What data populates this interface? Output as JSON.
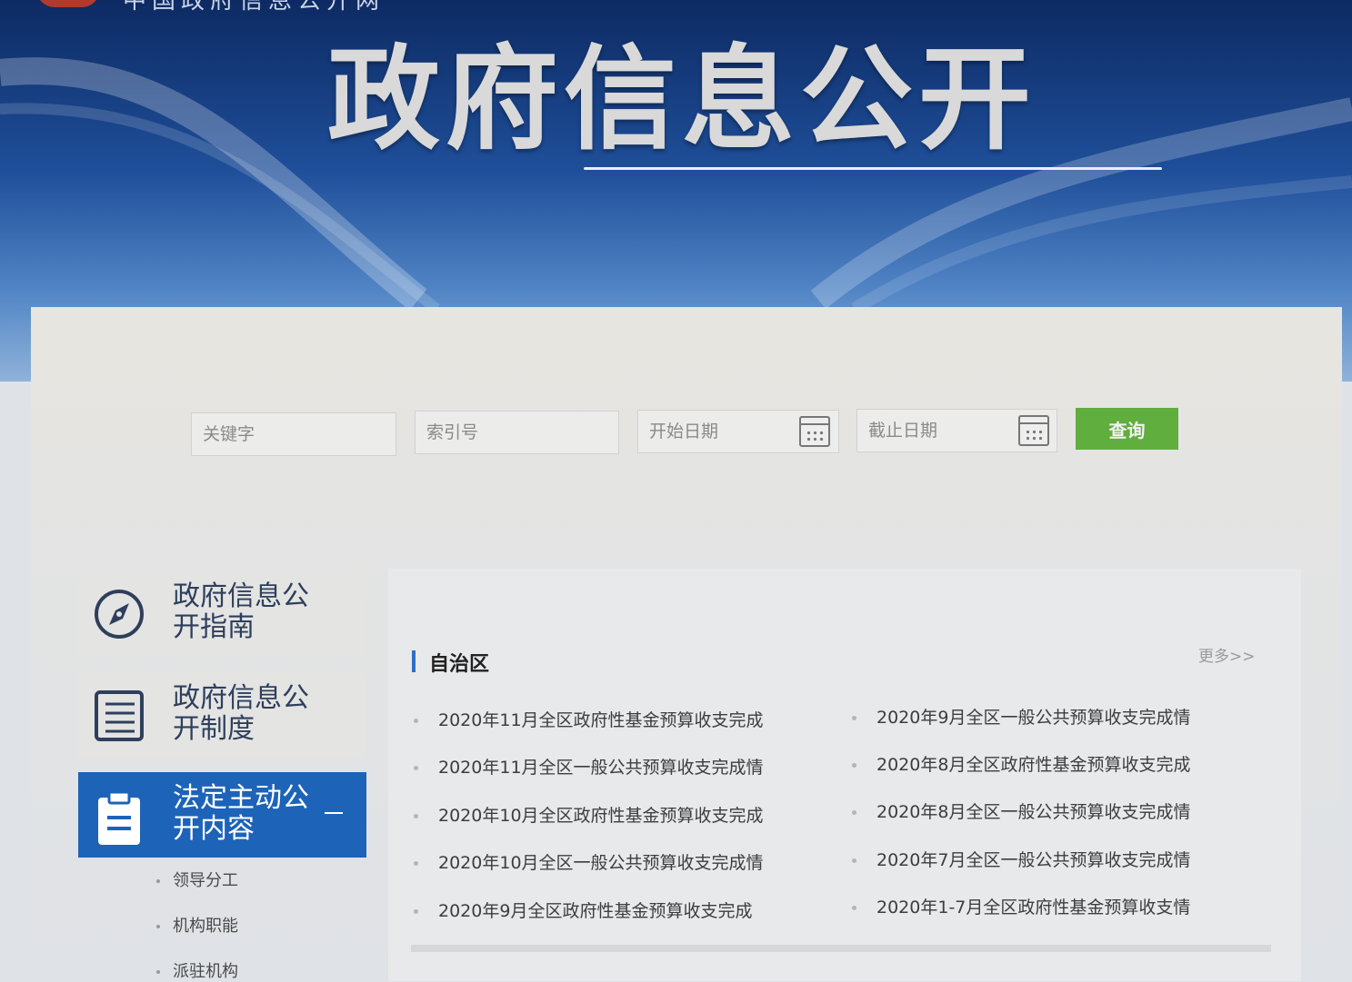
{
  "header": {
    "site_name": "中国政府信息公开网",
    "title": "政府信息公开"
  },
  "search": {
    "keyword_placeholder": "关键字",
    "index_placeholder": "索引号",
    "start_date_placeholder": "开始日期",
    "end_date_placeholder": "截止日期",
    "query_label": "查询"
  },
  "sidebar": {
    "items": [
      {
        "label": "政府信息公开指南",
        "icon": "compass-icon"
      },
      {
        "label": "政府信息公开制度",
        "icon": "list-icon"
      },
      {
        "label": "法定主动公开内容",
        "icon": "clipboard-icon",
        "active": true,
        "toggle": "–"
      }
    ],
    "sub_items": [
      "领导分工",
      "机构职能",
      "派驻机构"
    ]
  },
  "content": {
    "section_title": "自治区",
    "more_label": "更多>>",
    "news_left": [
      "2020年11月全区政府性基金预算收支完成",
      "2020年11月全区一般公共预算收支完成情",
      "2020年10月全区政府性基金预算收支完成",
      "2020年10月全区一般公共预算收支完成情",
      "2020年9月全区政府性基金预算收支完成"
    ],
    "news_right": [
      "2020年9月全区一般公共预算收支完成情",
      "2020年8月全区政府性基金预算收支完成",
      "2020年8月全区一般公共预算收支完成情",
      "2020年7月全区一般公共预算收支完成情",
      "2020年1-7月全区政府性基金预算收支情"
    ]
  },
  "colors": {
    "accent": "#1d63b8",
    "query_button": "#5fae3e",
    "banner_dark": "#0d2a63"
  }
}
